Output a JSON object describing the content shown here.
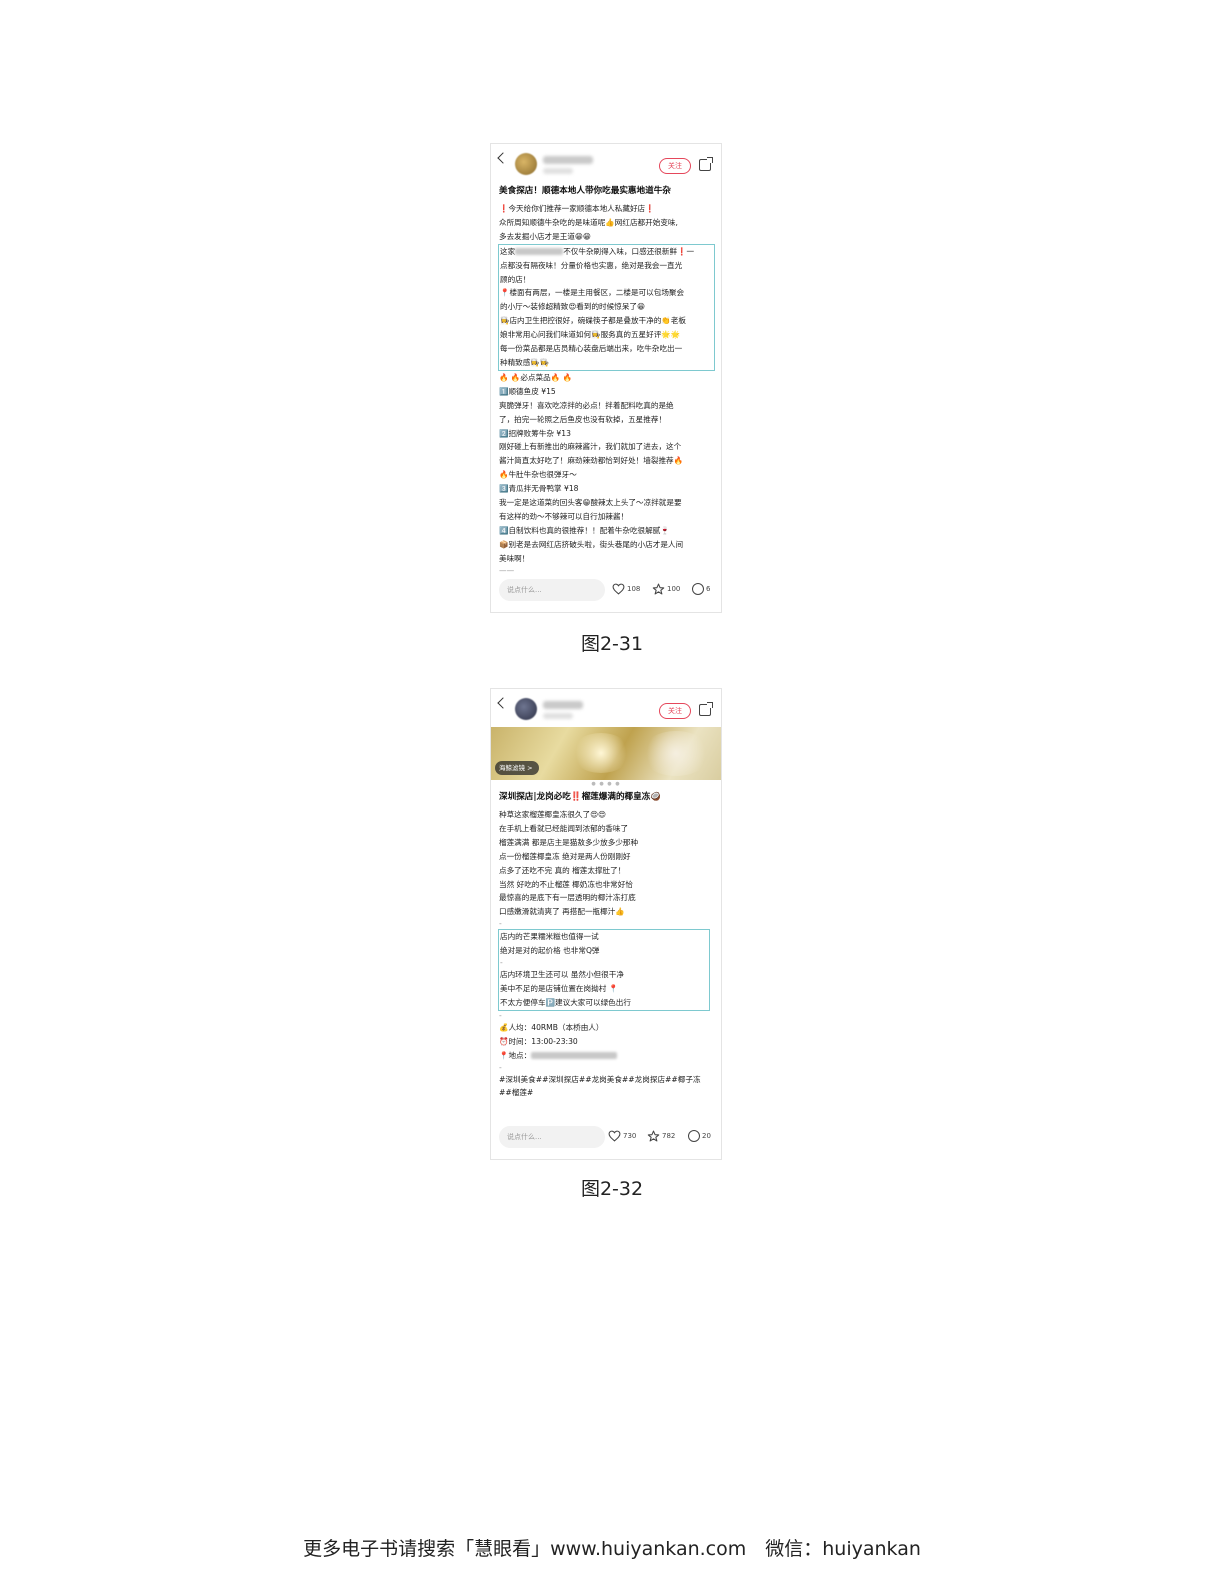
{
  "post1": {
    "follow": "关注",
    "title": "美食探店！顺德本地人带你吃最实惠地道牛杂",
    "lines_top": [
      "❗今天给你们推荐一家顺德本地人私藏好店❗",
      "众所周知顺德牛杂吃的是味道呢👍网红店都开始变味,",
      "多去发掘小店才是王道😁😁"
    ],
    "hl_first_pre": "这家",
    "hl_first_post": "不仅牛杂刷得入味，口感还很新鲜❗一",
    "lines_hl": [
      "点都没有隔夜味！分量价格也实惠，绝对是我会一直光",
      "顾的店！",
      "📍楼面有两层，一楼是主用餐区，二楼是可以包场聚会",
      "的小厅～装修超精致😍看到的时候惊呆了😁",
      "👩‍🍳店内卫生把控很好，碗碟筷子都是叠放干净的👏老板",
      "娘非常用心问我们味道如何👩‍🍳服务真的五星好评🌟🌟",
      "每一份菜品都是店员精心装盘后端出来，吃牛杂吃出一",
      "种精致感👩‍🍳👩‍🍳"
    ],
    "lines_bottom": [
      "🔥 🔥必点菜品🔥 🔥",
      "1️⃣顺德鱼皮 ¥15",
      "爽脆弹牙！喜欢吃凉拌的必点！拌着配料吃真的是绝",
      "了，拍完一轮照之后鱼皮也没有软掉，五星推荐！",
      "2️⃣招牌败筹牛杂 ¥13",
      "刚好碰上有新推出的麻辣酱汁，我们就加了进去，这个",
      "酱汁简直太好吃了！麻劲辣劲都恰到好处！墙裂推荐🔥",
      "🔥牛肚牛杂也很弹牙～",
      "3️⃣青瓜拌无骨鸭掌 ¥18",
      "我一定是这道菜的回头客😁酸辣太上头了～凉拌就是要",
      "有这样的劲～不够辣可以自行加辣酱！",
      "4️⃣自制饮料也真的很推荐！！配着牛杂吃很解腻🍷",
      "📦别老是去网红店挤破头啦，街头巷尾的小店才是人间",
      "美味啊！"
    ],
    "input_placeholder": "说点什么...",
    "likes": "108",
    "stars": "100",
    "comments": "6"
  },
  "caption1": "图2-31",
  "post2": {
    "follow": "关注",
    "filter_tag": "海鲸滤镜 >",
    "title": "深圳探店|龙岗必吃‼️榴莲爆满的椰皇冻🥥",
    "lines_top": [
      "种草这家榴莲椰皇冻很久了😍😍",
      "在手机上看就已经能闻到浓郁的香味了",
      "榴莲满满 都是店主是猫敖多少放多少那种",
      "点一份榴莲椰皇冻 绝对是两人份刚刚好",
      "点多了还吃不完 真的 榴莲太撑肚了！",
      "当然 好吃的不止榴莲 椰奶冻也非常好恰",
      "最惊喜的是底下有一层透明的椰汁冻打底",
      "口感嫩滑就清爽了 再搭配一瓶椰汁👍"
    ],
    "lines_hl": [
      "店内的芒果糯米糍也值得一试",
      "绝对是对的起价格 也非常Q弹",
      "-",
      "店内环境卫生还可以 虽然小但很干净",
      "美中不足的是店铺位置在岗拗村 📍",
      "不太方便停车🅿️建议大家可以绿色出行"
    ],
    "info_price": "💰人均：40RMB（本桥由人）",
    "info_time": "⏰时间：13:00-23:30",
    "info_addr_label": "📍地点：",
    "tags_line1": "#深圳美食##深圳探店##龙岗美食##龙岗探店##椰子冻",
    "tags_line2": "##榴莲#",
    "input_placeholder": "说点什么...",
    "likes": "730",
    "stars": "782",
    "comments": "20"
  },
  "caption2": "图2-32",
  "footer": "更多电子书请搜索「慧眼看」www.huiyankan.com　微信：huiyankan"
}
